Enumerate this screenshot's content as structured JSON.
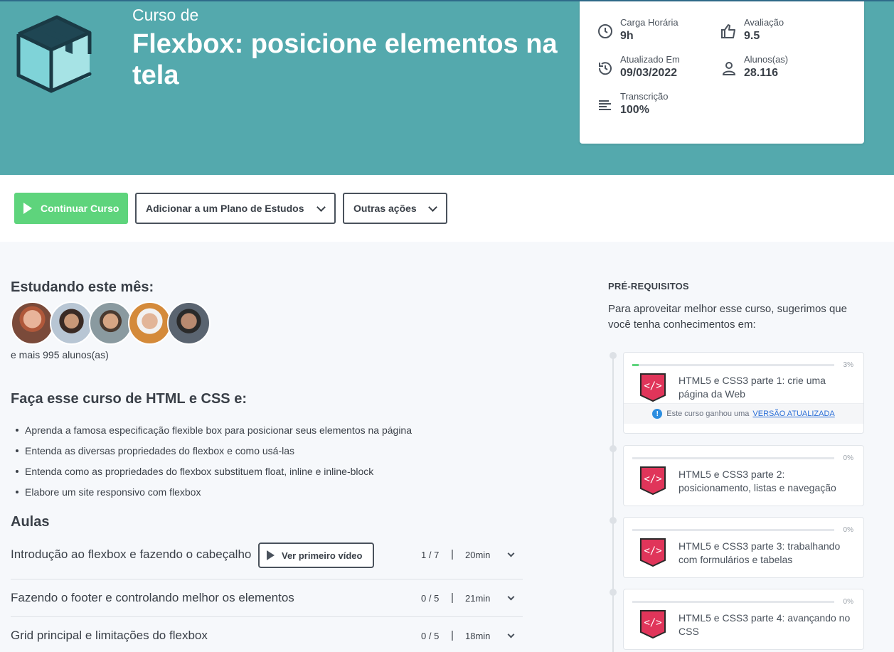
{
  "hero": {
    "kicker": "Curso de",
    "title": "Flexbox: posicione elementos na tela"
  },
  "stats": {
    "workload": {
      "label": "Carga Horária",
      "value": "9h",
      "icon": "clock-icon"
    },
    "rating": {
      "label": "Avaliação",
      "value": "9.5",
      "icon": "thumbs-up-icon"
    },
    "updated": {
      "label": "Atualizado Em",
      "value": "09/03/2022",
      "icon": "history-icon"
    },
    "students": {
      "label": "Alunos(as)",
      "value": "28.116",
      "icon": "person-icon"
    },
    "transcript": {
      "label": "Transcrição",
      "value": "100%",
      "icon": "lines-icon"
    }
  },
  "actions": {
    "continue_label": "Continuar Curso",
    "plan_label": "Adicionar a um Plano de Estudos",
    "other_label": "Outras ações"
  },
  "studying": {
    "title": "Estudando este mês:",
    "more": "e mais 995 alunos(as)"
  },
  "course_intro": {
    "title": "Faça esse curso de HTML e CSS e:",
    "bullets": [
      "Aprenda a famosa especificação flexible box para posicionar seus elementos na página",
      "Entenda as diversas propriedades do flexbox e como usá-las",
      "Entenda como as propriedades do flexbox substituem float, inline e inline-block",
      "Elabore um site responsivo com flexbox"
    ]
  },
  "lessons": {
    "title": "Aulas",
    "first_video_label": "Ver primeiro vídeo",
    "separator": "|",
    "items": [
      {
        "title": "Introdução ao flexbox e fazendo o cabeçalho",
        "progress": "1 / 7",
        "duration": "20min"
      },
      {
        "title": "Fazendo o footer e controlando melhor os elementos",
        "progress": "0 / 5",
        "duration": "21min"
      },
      {
        "title": "Grid principal e limitações do flexbox",
        "progress": "0 / 5",
        "duration": "18min"
      }
    ]
  },
  "prerequisites": {
    "title": "PRÉ-REQUISITOS",
    "intro": "Para aproveitar melhor esse curso, sugerimos que você tenha conhecimentos em:",
    "notice_text": "Este curso ganhou uma",
    "notice_link": "VERSÃO ATUALIZADA",
    "items": [
      {
        "name": "HTML5 e CSS3 parte 1: crie uma página da Web",
        "percent": "3%",
        "progress": 0.03
      },
      {
        "name": "HTML5 e CSS3 parte 2: posicionamento, listas e navegação",
        "percent": "0%",
        "progress": 0
      },
      {
        "name": "HTML5 e CSS3 parte 3: trabalhando com formulários e tabelas",
        "percent": "0%",
        "progress": 0
      },
      {
        "name": "HTML5 e CSS3 parte 4: avançando no CSS",
        "percent": "0%",
        "progress": 0
      }
    ]
  },
  "colors": {
    "hero_bg": "#54a9ad",
    "continue_green": "#5ed47c",
    "icon_pink": "#e0355a",
    "link_blue": "#2b6fd8"
  }
}
